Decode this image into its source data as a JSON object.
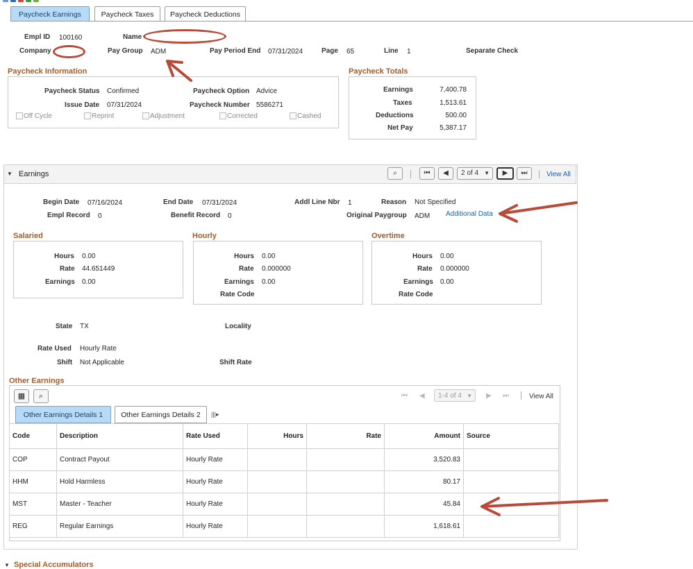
{
  "tabs": [
    {
      "label": "Paycheck Earnings"
    },
    {
      "label": "Paycheck Taxes"
    },
    {
      "label": "Paycheck Deductions"
    }
  ],
  "header": {
    "empl_id_label": "Empl ID",
    "empl_id": "100160",
    "name_label": "Name",
    "company_label": "Company",
    "pay_group_label": "Pay Group",
    "pay_group": "ADM",
    "pay_period_end_label": "Pay Period End",
    "pay_period_end": "07/31/2024",
    "page_label": "Page",
    "page": "65",
    "line_label": "Line",
    "line": "1",
    "separate_check_label": "Separate Check"
  },
  "paycheck_info": {
    "title": "Paycheck Information",
    "status_label": "Paycheck Status",
    "status": "Confirmed",
    "option_label": "Paycheck Option",
    "option": "Advice",
    "issue_date_label": "Issue Date",
    "issue_date": "07/31/2024",
    "number_label": "Paycheck Number",
    "number": "5586271",
    "checkboxes": [
      "Off Cycle",
      "Reprint",
      "Adjustment",
      "Corrected",
      "Cashed"
    ]
  },
  "paycheck_totals": {
    "title": "Paycheck Totals",
    "earnings_label": "Earnings",
    "earnings": "7,400.78",
    "taxes_label": "Taxes",
    "taxes": "1,513.61",
    "deductions_label": "Deductions",
    "deductions": "500.00",
    "net_pay_label": "Net Pay",
    "net_pay": "5,387.17"
  },
  "earnings": {
    "title": "Earnings",
    "pager": "2 of 4",
    "view_all": "View All",
    "begin_date_label": "Begin Date",
    "begin_date": "07/16/2024",
    "end_date_label": "End Date",
    "end_date": "07/31/2024",
    "addl_line_label": "Addl Line Nbr",
    "addl_line": "1",
    "reason_label": "Reason",
    "reason": "Not Specified",
    "empl_record_label": "Empl Record",
    "empl_record": "0",
    "benefit_record_label": "Benefit Record",
    "benefit_record": "0",
    "orig_paygroup_label": "Original Paygroup",
    "orig_paygroup": "ADM",
    "additional_data": "Additional Data",
    "salaried": {
      "title": "Salaried",
      "hours_label": "Hours",
      "hours": "0.00",
      "rate_label": "Rate",
      "rate": "44.651449",
      "earnings_label": "Earnings",
      "earnings": "0.00"
    },
    "hourly": {
      "title": "Hourly",
      "hours_label": "Hours",
      "hours": "0.00",
      "rate_label": "Rate",
      "rate": "0.000000",
      "earnings_label": "Earnings",
      "earnings": "0.00",
      "rate_code_label": "Rate Code"
    },
    "overtime": {
      "title": "Overtime",
      "hours_label": "Hours",
      "hours": "0.00",
      "rate_label": "Rate",
      "rate": "0.000000",
      "earnings_label": "Earnings",
      "earnings": "0.00",
      "rate_code_label": "Rate Code"
    },
    "state_label": "State",
    "state": "TX",
    "locality_label": "Locality",
    "rate_used_label": "Rate Used",
    "rate_used": "Hourly Rate",
    "shift_label": "Shift",
    "shift": "Not Applicable",
    "shift_rate_label": "Shift Rate"
  },
  "other_earnings": {
    "title": "Other Earnings",
    "pager": "1-4 of 4",
    "view_all": "View All",
    "tabs": [
      "Other Earnings Details 1",
      "Other Earnings Details 2"
    ],
    "columns": [
      "Code",
      "Description",
      "Rate Used",
      "Hours",
      "Rate",
      "Amount",
      "Source"
    ],
    "rows": [
      [
        "COP",
        "Contract Payout",
        "Hourly Rate",
        "",
        "",
        "3,520.83",
        ""
      ],
      [
        "HHM",
        "Hold Harmless",
        "Hourly Rate",
        "",
        "",
        "80.17",
        ""
      ],
      [
        "MST",
        "Master - Teacher",
        "Hourly Rate",
        "",
        "",
        "45.84",
        ""
      ],
      [
        "REG",
        "Regular Earnings",
        "Hourly Rate",
        "",
        "",
        "1,618.61",
        ""
      ]
    ]
  },
  "special_accumulators": {
    "title": "Special Accumulators"
  },
  "colors": {
    "accent": "#a35b2b",
    "tab_active": "#b7dbf7",
    "annotation": "#b84a3a"
  }
}
